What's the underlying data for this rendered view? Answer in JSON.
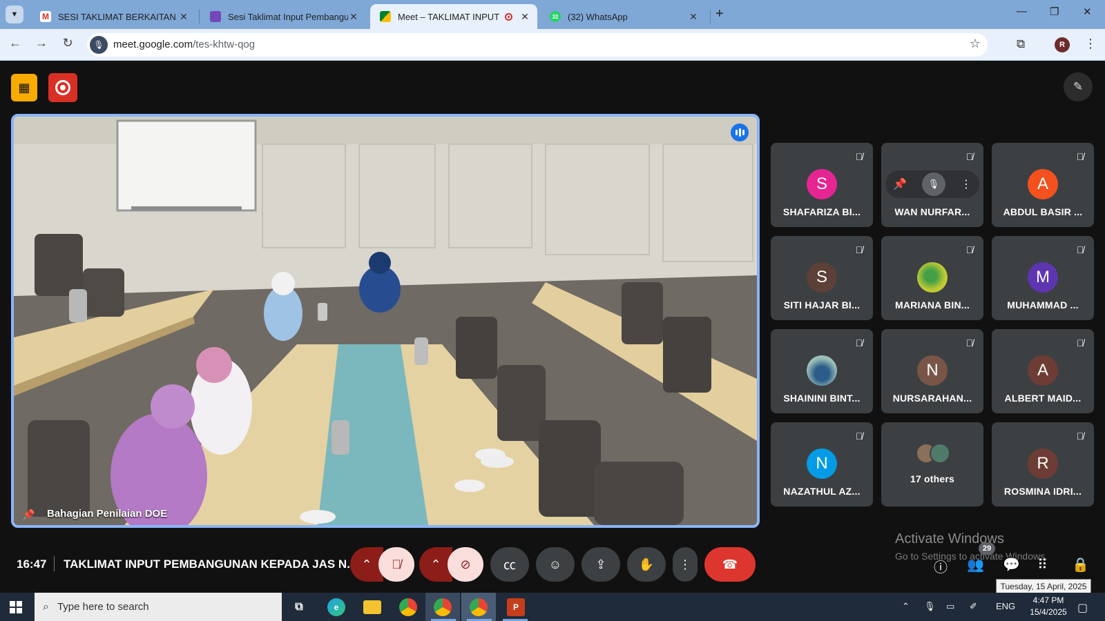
{
  "browser": {
    "tabs": [
      {
        "title": "SESI TAKLIMAT BERKAITAN INPUT",
        "favicon": "gmail-icon",
        "active": false
      },
      {
        "title": "Sesi Taklimat Input Pembangunan",
        "favicon": "forms-icon",
        "active": false
      },
      {
        "title": "Meet – TAKLIMAT INPUT PEMB",
        "favicon": "meet-icon",
        "active": true,
        "recording": true
      },
      {
        "title": "(32) WhatsApp",
        "favicon": "whatsapp-icon",
        "active": false
      }
    ],
    "url_host": "meet.google.com",
    "url_path": "/tes-khtw-qog",
    "profile_initial": "R",
    "whatsapp_count": "32"
  },
  "meet": {
    "main_speaker": "Bahagian Penilaian DOE",
    "participants": [
      {
        "name": "SHAFARIZA BI...",
        "initial": "S",
        "color": "#e52592",
        "muted": true
      },
      {
        "name": "WAN NURFAR...",
        "initial": "",
        "color": "#5f6368",
        "muted": true,
        "hovered": true
      },
      {
        "name": "ABDUL BASIR ...",
        "initial": "A",
        "color": "#f4511e",
        "muted": true
      },
      {
        "name": "SITI HAJAR BI...",
        "initial": "S",
        "color": "#5d4037",
        "muted": true
      },
      {
        "name": "MARIANA BIN...",
        "initial": "",
        "color": "#c0ca33",
        "muted": true,
        "photo": true
      },
      {
        "name": "MUHAMMAD ...",
        "initial": "M",
        "color": "#5e35b1",
        "muted": true
      },
      {
        "name": "SHAININI BINT...",
        "initial": "",
        "color": "#80a0a0",
        "muted": true,
        "photo": true
      },
      {
        "name": "NURSARAHAN...",
        "initial": "N",
        "color": "#795548",
        "muted": true
      },
      {
        "name": "ALBERT MAID...",
        "initial": "A",
        "color": "#6d3d35",
        "muted": true
      },
      {
        "name": "NAZATHUL AZ...",
        "initial": "N",
        "color": "#039be5",
        "muted": true
      },
      {
        "name": "17 others",
        "initial": "",
        "color": "#3c4043",
        "muted": false,
        "group": true
      },
      {
        "name": "ROSMINA IDRI...",
        "initial": "R",
        "color": "#6d3d35",
        "muted": true
      }
    ],
    "clock": "16:47",
    "meeting_title": "TAKLIMAT INPUT PEMBANGUNAN KEPADA JAS N...",
    "people_count": "29",
    "accent": "#8ab4f8",
    "end_call_color": "#dc362e"
  },
  "watermark": {
    "line1": "Activate Windows",
    "line2": "Go to Settings to activate Windows."
  },
  "tooltip": "Tuesday, 15 April, 2025",
  "taskbar": {
    "search_placeholder": "Type here to search",
    "language": "ENG",
    "time": "4:47 PM",
    "date": "15/4/2025"
  }
}
